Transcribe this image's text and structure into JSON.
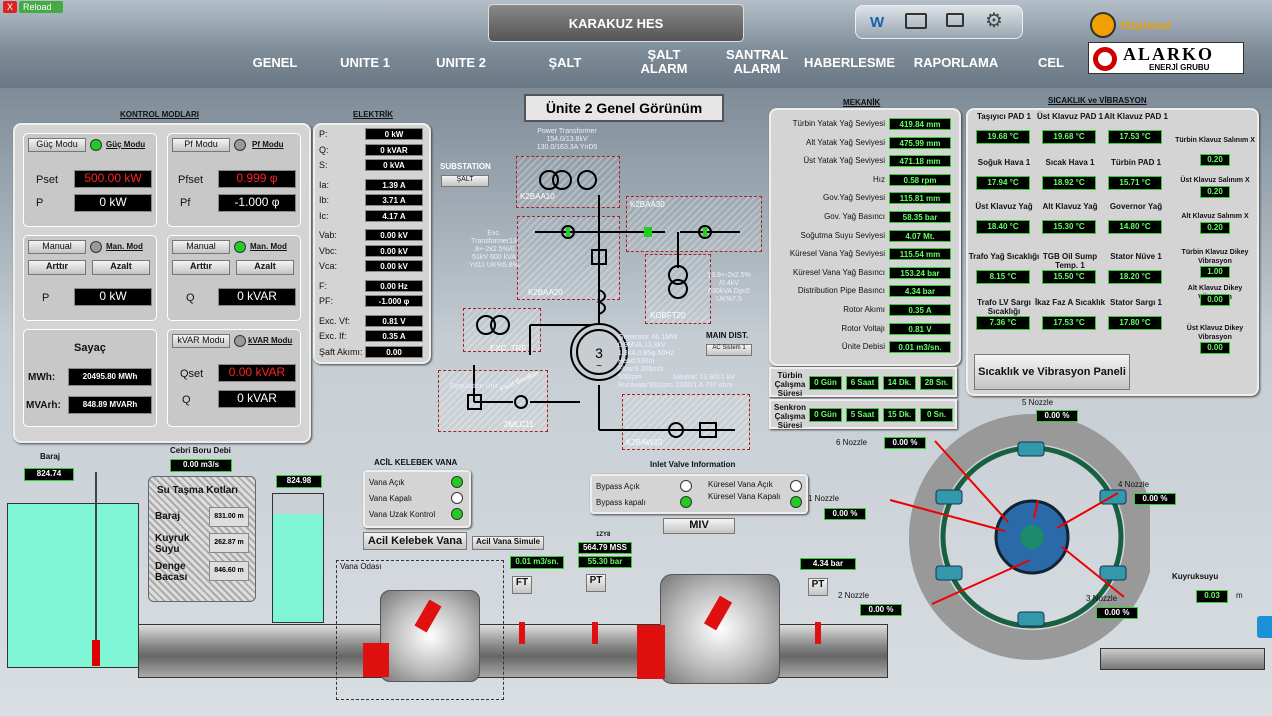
{
  "topbar": {
    "close": "X",
    "reload": "Reload"
  },
  "header": {
    "title": "KARAKUZ HES",
    "logo1": "TEQGlobal",
    "logo2": "ALARKO",
    "logo2_sub": "ENERJİ GRUBU"
  },
  "nav": [
    "GENEL",
    "UNITE 1",
    "UNITE 2",
    "ŞALT",
    "ŞALT ALARM",
    "SANTRAL ALARM",
    "HABERLESME",
    "RAPORLAMA",
    "CEL"
  ],
  "page_title": "Ünite 2 Genel Görünüm",
  "kontrol": {
    "title": "KONTROL MODLARI",
    "guc": {
      "btn": "Güç Modu",
      "label": "Güç Modu",
      "pset_l": "Pset",
      "pset": "500.00 kW",
      "p_l": "P",
      "p": "0 kW"
    },
    "pf": {
      "btn": "Pf Modu",
      "label": "Pf Modu",
      "pfset_l": "Pfset",
      "pfset": "0.999 φ",
      "pf_l": "Pf",
      "pf": "-1.000 φ"
    },
    "manual1": {
      "btn": "Manual",
      "label": "Man. Mod",
      "up": "Arttır",
      "down": "Azalt",
      "p_l": "P",
      "p": "0 kW"
    },
    "manual2": {
      "btn": "Manual",
      "label": "Man. Mod",
      "up": "Arttır",
      "down": "Azalt",
      "q_l": "Q",
      "q": "0 kVAR"
    },
    "sayac": {
      "title": "Sayaç",
      "mwh_l": "MWh:",
      "mwh": "20495.80 MWh",
      "mvarh_l": "MVArh:",
      "mvarh": "848.89 MVARh"
    },
    "kvar": {
      "btn": "kVAR Modu",
      "label": "kVAR Modu",
      "qset_l": "Qset",
      "qset": "0.00 kVAR",
      "q_l": "Q",
      "q": "0 kVAR"
    }
  },
  "elektrik": {
    "title": "ELEKTRİK",
    "rows": [
      {
        "l": "P:",
        "v": "0 kW"
      },
      {
        "l": "Q:",
        "v": "0 kVAR"
      },
      {
        "l": "S:",
        "v": "0 kVA"
      },
      {
        "l": "Ia:",
        "v": "1.39 A"
      },
      {
        "l": "Ib:",
        "v": "3.71 A"
      },
      {
        "l": "Ic:",
        "v": "4.17 A"
      },
      {
        "l": "Vab:",
        "v": "0.00 kV"
      },
      {
        "l": "Vbc:",
        "v": "0.00 kV"
      },
      {
        "l": "Vca:",
        "v": "0.00 kV"
      },
      {
        "l": "F:",
        "v": "0.00 Hz"
      },
      {
        "l": "PF:",
        "v": "-1.000 φ"
      },
      {
        "l": "Exc. Vf:",
        "v": "0.81 V"
      },
      {
        "l": "Exc. If:",
        "v": "0.35 A"
      },
      {
        "l": "Şaft Akımı:",
        "v": "0.00"
      }
    ]
  },
  "sld": {
    "substation": "SUBSTATION",
    "salt_btn": "ŞALT",
    "power_tr": "Power Transformer\n154.0/13.8kV\n130.0/163.3A YnD5",
    "k2baa10": "K2BAA10",
    "k2baa30": "K2BAA30",
    "k2baa20": "K2BAA20",
    "kobft20": "KOBFT20",
    "exc_trf": "EXC. TRF",
    "exc_info": "Exc.\nTransformer13\n.8+-2x2.5%/0\n51kV 600 kVA\nYd11 UK%5.8%",
    "aux_info": "13.8+-2x2.5%\n/0.4kV\n630kVA Dyn5\nUK%7.5",
    "gen_info": "Generator 46.1MW\n0.9MVA 13.8kV\n1.3kA 0.85φ 50Hz\nHead:530m\nFlow:8.205m/s\n500rpm\nRunaway:931rpm",
    "neutral": "Neutral: 13.8/0.1 kV\n2000/1 A 797 ohm",
    "main_dist": "MAIN DIST.",
    "ac_btn": "AC Sistem 1",
    "reg": "Regulation Unit",
    "field": "Field Breaker",
    "mlc": "2MLC11",
    "k2baw10": "K2BAW10"
  },
  "mekanik": {
    "title": "MEKANİK",
    "rows": [
      {
        "l": "Türbin Yatak Yağ Seviyesi",
        "v": "419.84 mm"
      },
      {
        "l": "Alt Yatak Yağ Seviyesi",
        "v": "475.99 mm"
      },
      {
        "l": "Üst Yatak Yağ Seviyesi",
        "v": "471.18 mm"
      },
      {
        "l": "Hız",
        "v": "0.58 rpm"
      },
      {
        "l": "Gov.Yağ Seviyesi",
        "v": "115.81 mm"
      },
      {
        "l": "Gov. Yağ Basıncı",
        "v": "58.35 bar"
      },
      {
        "l": "Soğutma Suyu Seviyesi",
        "v": "4.07 Mt."
      },
      {
        "l": "Küresel Vana Yağ Seviyesi",
        "v": "115.54 mm"
      },
      {
        "l": "Küresel Vana Yağ Basıncı",
        "v": "153.24 bar"
      },
      {
        "l": "Distribution Pipe Basıncı",
        "v": "4.34 bar"
      },
      {
        "l": "Rotor Akımı",
        "v": "0.35 A"
      },
      {
        "l": "Rotor Voltajı",
        "v": "0.81 V"
      },
      {
        "l": "Ünite Debisi",
        "v": "0.01 m3/sn."
      }
    ],
    "turbin_l": "Türbin Çalışma Süresi",
    "turbin": [
      "0 Gün",
      "6 Saat",
      "14 Dk.",
      "28 Sn."
    ],
    "senkron_l": "Senkron Çalışma Süresi",
    "senkron": [
      "0 Gün",
      "5 Saat",
      "15 Dk.",
      "0 Sn."
    ]
  },
  "sicaklik": {
    "title": "SICAKLIK ve VİBRASYON",
    "cells": [
      {
        "l": "Taşıyıcı PAD 1",
        "v": "19.68 °C"
      },
      {
        "l": "Üst Klavuz PAD 1",
        "v": "19.68 °C"
      },
      {
        "l": "Alt Klavuz PAD 1",
        "v": "17.53 °C"
      },
      {
        "l": "Soğuk Hava 1",
        "v": "17.94 °C"
      },
      {
        "l": "Sıcak Hava 1",
        "v": "18.92 °C"
      },
      {
        "l": "Türbin PAD 1",
        "v": "15.71 °C"
      },
      {
        "l": "Üst Klavuz Yağ",
        "v": "18.40 °C"
      },
      {
        "l": "Alt Klavuz Yağ",
        "v": "15.30 °C"
      },
      {
        "l": "Governor Yağ",
        "v": "14.80 °C"
      },
      {
        "l": "Trafo Yağ Sıcaklığı",
        "v": "8.15 °C"
      },
      {
        "l": "TGB Oil Sump Temp. 1",
        "v": "15.50 °C"
      },
      {
        "l": "Stator Nüve 1",
        "v": "18.20 °C"
      },
      {
        "l": "Trafo LV Sargı Sıcaklığı",
        "v": "7.36 °C"
      },
      {
        "l": "İkaz Faz A Sıcaklık",
        "v": "17.53 °C"
      },
      {
        "l": "Stator Sargı 1",
        "v": "17.80 °C"
      }
    ],
    "vib": [
      {
        "l": "Türbin Klavuz Salınım X",
        "v": "0.20"
      },
      {
        "l": "Üst Klavuz Salınım X",
        "v": "0.20"
      },
      {
        "l": "Alt Klavuz Salınım X",
        "v": "0.20"
      },
      {
        "l": "Türbin Klavuz Dikey Vibrasyon",
        "v": "1.00"
      },
      {
        "l": "Alt Klavuz Dikey Vibrasyon",
        "v": "0.00"
      },
      {
        "l": "Üst Klavuz Dikey Vibrasyon",
        "v": "0.00"
      }
    ],
    "panel_btn": "Sıcaklık ve Vibrasyon Paneli"
  },
  "hydro": {
    "baraj_l": "Baraj",
    "baraj": "824.74",
    "cebri_l": "Cebri Boru Debi",
    "cebri": "0.00 m3/s",
    "tank2": "824.98",
    "su_title": "Su Taşma Kotları",
    "su_rows": [
      {
        "l": "Baraj",
        "v": "831.00 m"
      },
      {
        "l": "Kuyruk Suyu",
        "v": "262.87 m"
      },
      {
        "l": "Denge Bacası",
        "v": "846.60 m"
      }
    ],
    "acil_title": "ACİL KELEBEK VANA",
    "acil_rows": [
      "Vana Açık",
      "Vana Kapalı",
      "Vana Uzak Kontrol"
    ],
    "acil_btn": "Acil Kelebek Vana",
    "sim_btn": "Acil Vana Simule",
    "vana_odasi": "Vana Odası",
    "inlet_title": "Inlet Valve Information",
    "bypass": [
      "Bypass Açık",
      "Bypass kapalı"
    ],
    "kuresel": [
      "Küresel Vana Açık",
      "Küresel Vana Kapalı"
    ],
    "miv": "MIV",
    "ft_val": "0.01 m3/sn.",
    "ft": "FT",
    "pt1_tag": "1ZY8",
    "pt1a": "564.79 MSS",
    "pt1b": "55.30 bar",
    "pt": "PT",
    "pt2": "4.34 bar",
    "nozzles": [
      {
        "l": "5 Nozzle",
        "v": "0.00 %"
      },
      {
        "l": "6 Nozzle",
        "v": "0.00 %"
      },
      {
        "l": "4 Nozzle",
        "v": "0.00 %"
      },
      {
        "l": "1 Nozzle",
        "v": "0.00 %"
      },
      {
        "l": "2 Nozzle",
        "v": "0.00 %"
      },
      {
        "l": "3 Nozzle",
        "v": "0.00 %"
      }
    ],
    "kuyruk_l": "Kuyruksuyu",
    "kuyruk": "0.03",
    "kuyruk_u": "m"
  }
}
